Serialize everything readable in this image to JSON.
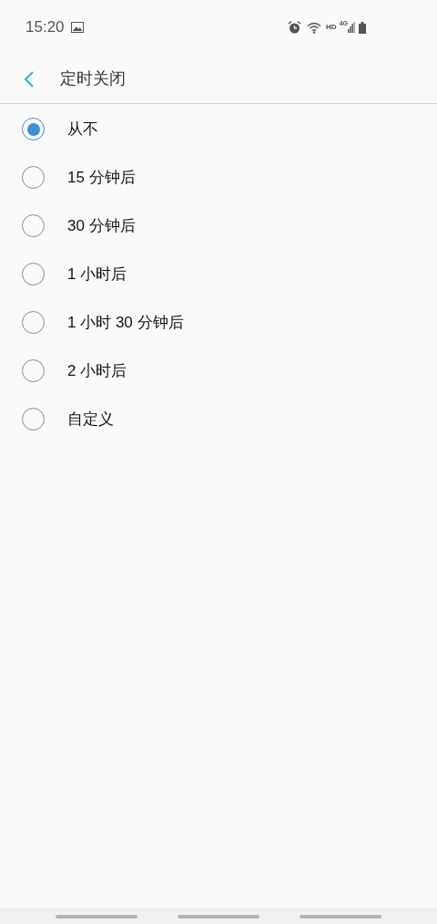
{
  "status_bar": {
    "time": "15:20",
    "hd": "HD",
    "network": "4G"
  },
  "header": {
    "title": "定时关闭"
  },
  "options": [
    {
      "label": "从不",
      "selected": true
    },
    {
      "label": "15 分钟后",
      "selected": false
    },
    {
      "label": "30 分钟后",
      "selected": false
    },
    {
      "label": "1 小时后",
      "selected": false
    },
    {
      "label": "1 小时 30 分钟后",
      "selected": false
    },
    {
      "label": "2 小时后",
      "selected": false
    },
    {
      "label": "自定义",
      "selected": false
    }
  ]
}
